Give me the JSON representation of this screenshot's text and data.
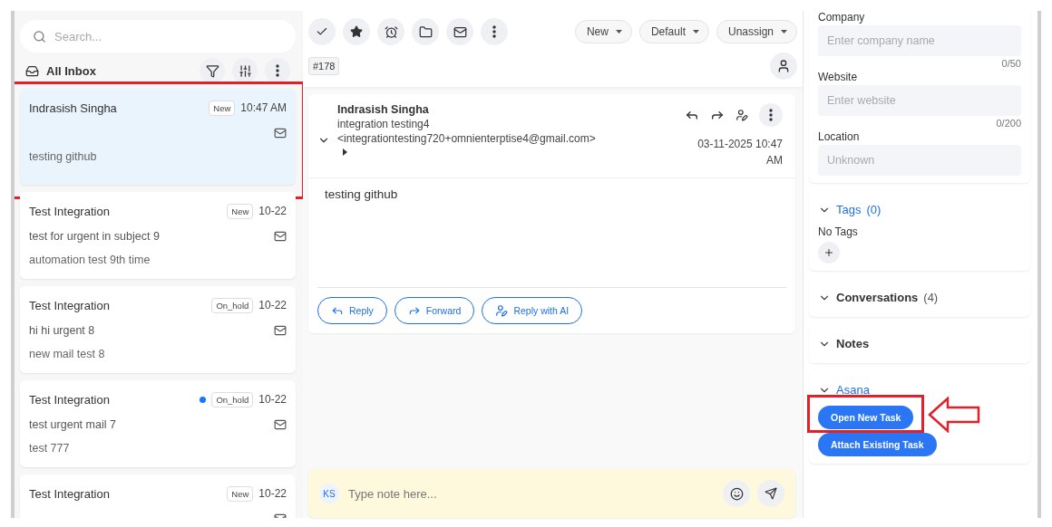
{
  "sidebar": {
    "search": {
      "placeholder": "Search..."
    },
    "inbox_title": "All Inbox",
    "emails": [
      {
        "sender": "Indrasish Singha",
        "status": "New",
        "time": "10:47 AM",
        "preview": "testing github",
        "unread": false,
        "selected": true,
        "highlighted": true
      },
      {
        "sender": "Test Integration",
        "status": "New",
        "time": "10-22",
        "subject": "test for urgent in subject 9",
        "preview": "automation test 9th time",
        "unread": false,
        "selected": false,
        "highlighted": false
      },
      {
        "sender": "Test Integration",
        "status": "On_hold",
        "time": "10-22",
        "subject": "hi hi urgent 8",
        "preview": "new mail test 8",
        "unread": false,
        "selected": false,
        "highlighted": false
      },
      {
        "sender": "Test Integration",
        "status": "On_hold",
        "time": "10-22",
        "subject": "test urgent mail 7",
        "preview": "test 777",
        "unread": true,
        "selected": false,
        "highlighted": false
      },
      {
        "sender": "Test Integration",
        "status": "New",
        "time": "10-22",
        "unread": false,
        "selected": false,
        "highlighted": false
      }
    ]
  },
  "toolbar": {
    "dropdowns": [
      "New",
      "Default",
      "Unassign"
    ],
    "ticket_id": "#178"
  },
  "message": {
    "sender": "Indrasish Singha",
    "from_name": "integration testing4",
    "from_address": "<integrationtesting720+omnienterptise4@gmail.com>",
    "date": "03-11-2025 10:47 AM",
    "body": "testing github",
    "actions": [
      {
        "kind": "reply",
        "label": "Reply"
      },
      {
        "kind": "forward",
        "label": "Forward"
      },
      {
        "kind": "ai",
        "label": "Reply with AI"
      }
    ]
  },
  "composer": {
    "initials": "KS",
    "placeholder": "Type note here..."
  },
  "details": {
    "fields": [
      {
        "label": "Company",
        "placeholder": "Enter company name",
        "counter": "0/50"
      },
      {
        "label": "Website",
        "placeholder": "Enter website",
        "counter": "0/200"
      },
      {
        "label": "Location",
        "placeholder": "Unknown"
      }
    ],
    "sections": [
      {
        "kind": "tags",
        "title": "Tags",
        "count": "(0)",
        "accent": true,
        "empty_text": "No Tags"
      },
      {
        "kind": "plain",
        "title": "Conversations",
        "count": "(4)",
        "accent": false
      },
      {
        "kind": "plain",
        "title": "Notes",
        "accent": false
      },
      {
        "kind": "asana",
        "title": "Asana",
        "accent": true,
        "buttons": [
          {
            "label": "Open New Task",
            "highlighted": true
          },
          {
            "label": "Attach Existing Task",
            "highlighted": false
          }
        ]
      }
    ]
  }
}
